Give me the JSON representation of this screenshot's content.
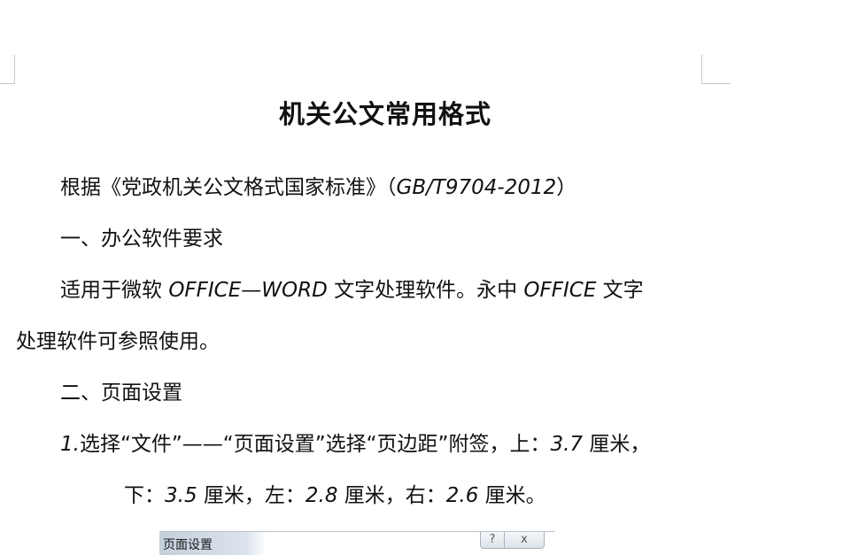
{
  "document": {
    "title": "机关公文常用格式",
    "p1": {
      "text": "根据《党政机关公文格式国家标准》（",
      "latin": "GB/T9704-2012",
      "end": "）"
    },
    "p2": {
      "text": "一、办公软件要求"
    },
    "p3": {
      "a": "适用于微软 ",
      "latin1": "OFFICE—WORD",
      "b": " 文字处理软件。永中 ",
      "latin2": "OFFICE",
      "c": " 文字"
    },
    "p4": {
      "text": "处理软件可参照使用。"
    },
    "p5": {
      "text": "二、页面设置"
    },
    "p6": {
      "num": "1.",
      "a": "选择“文件”——“页面设置”选择“页边距”附签，上：",
      "v1": "3.7",
      "b": " 厘米，"
    },
    "p7": {
      "a": "下：",
      "v1": "3.5",
      "b": " 厘米，左：",
      "v2": "2.8",
      "c": " 厘米，右：",
      "v3": "2.6",
      "d": " 厘米。"
    }
  },
  "dialog": {
    "title": "页面设置",
    "help_icon": "?",
    "close_icon": "x"
  }
}
